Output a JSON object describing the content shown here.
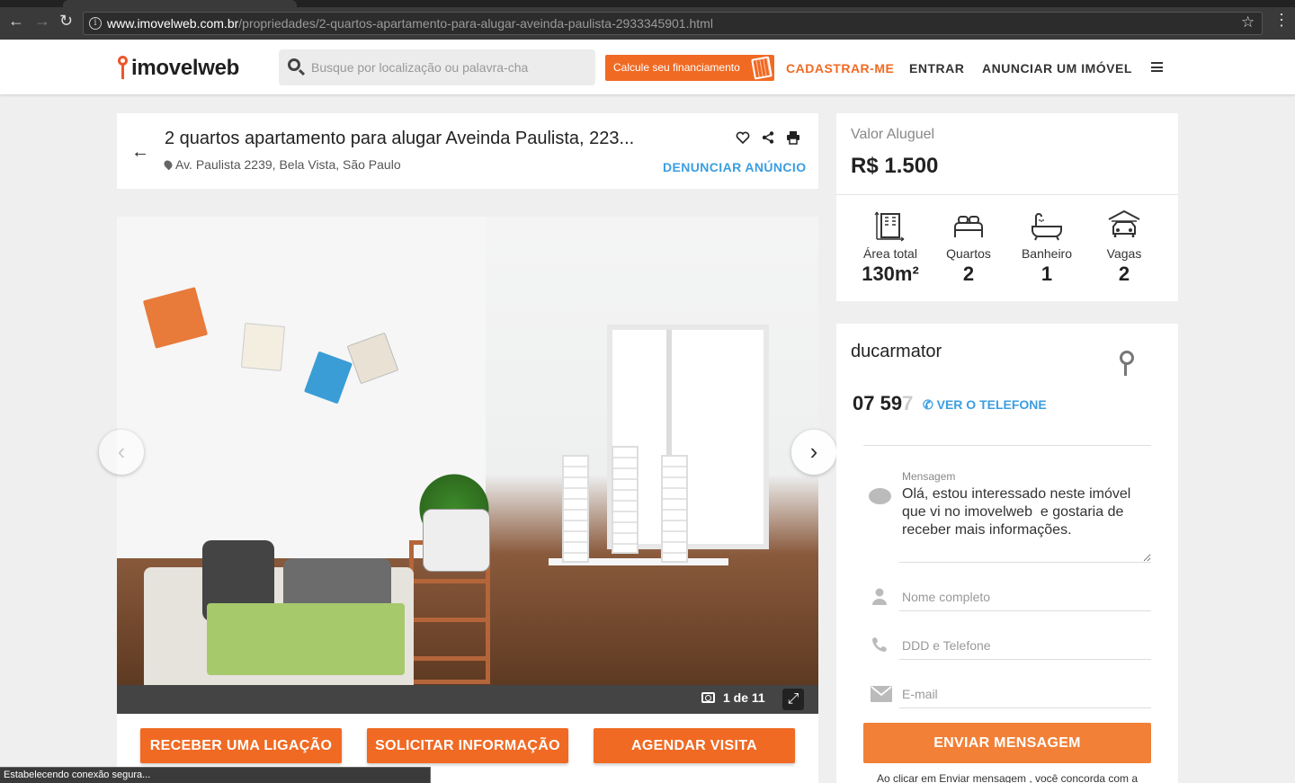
{
  "browser": {
    "url_host": "www.imovelweb.com.br",
    "url_path": "/propriedades/2-quartos-apartamento-para-alugar-aveinda-paulista-2933345901.html",
    "status": "Estabelecendo conexão segura..."
  },
  "header": {
    "logo": "imovelweb",
    "search_placeholder": "Busque por localização ou palavra-cha",
    "finance_label": "Calcule seu financiamento",
    "nav": [
      "CADASTRAR-ME",
      "ENTRAR",
      "ANUNCIAR UM IMÓVEL"
    ]
  },
  "listing": {
    "title": "2 quartos apartamento para alugar Aveinda Paulista, 223...",
    "address": "Av. Paulista 2239, Bela Vista, São Paulo",
    "report_label": "DENUNCIAR ANÚNCIO",
    "gallery_counter": "1 de 11",
    "cta": [
      "RECEBER UMA LIGAÇÃO",
      "SOLICITAR INFORMAÇÃO",
      "AGENDAR VISITA"
    ]
  },
  "price": {
    "label": "Valor Aluguel",
    "value": "R$ 1.500"
  },
  "features": [
    {
      "label": "Área total",
      "value": "130m²",
      "icon": "area-icon"
    },
    {
      "label": "Quartos",
      "value": "2",
      "icon": "bed-icon"
    },
    {
      "label": "Banheiro",
      "value": "1",
      "icon": "bathtub-icon"
    },
    {
      "label": "Vagas",
      "value": "2",
      "icon": "garage-icon"
    }
  ],
  "contact": {
    "advertiser": "ducarmator",
    "phone_visible": "07 59",
    "phone_faded": "7",
    "see_phone": "VER O TELEFONE",
    "message_label": "Mensagem",
    "message_text": "Olá, estou interessado neste imóvel que vi no imovelweb  e gostaria de receber mais informações.",
    "name_placeholder": "Nome completo",
    "phone_placeholder": "DDD e Telefone",
    "email_placeholder": "E-mail",
    "send_label": "ENVIAR MENSAGEM",
    "terms": "Ao clicar em Enviar mensagem , você concorda com a"
  },
  "colors": {
    "accent": "#f06a23",
    "link": "#3b9ee0"
  }
}
